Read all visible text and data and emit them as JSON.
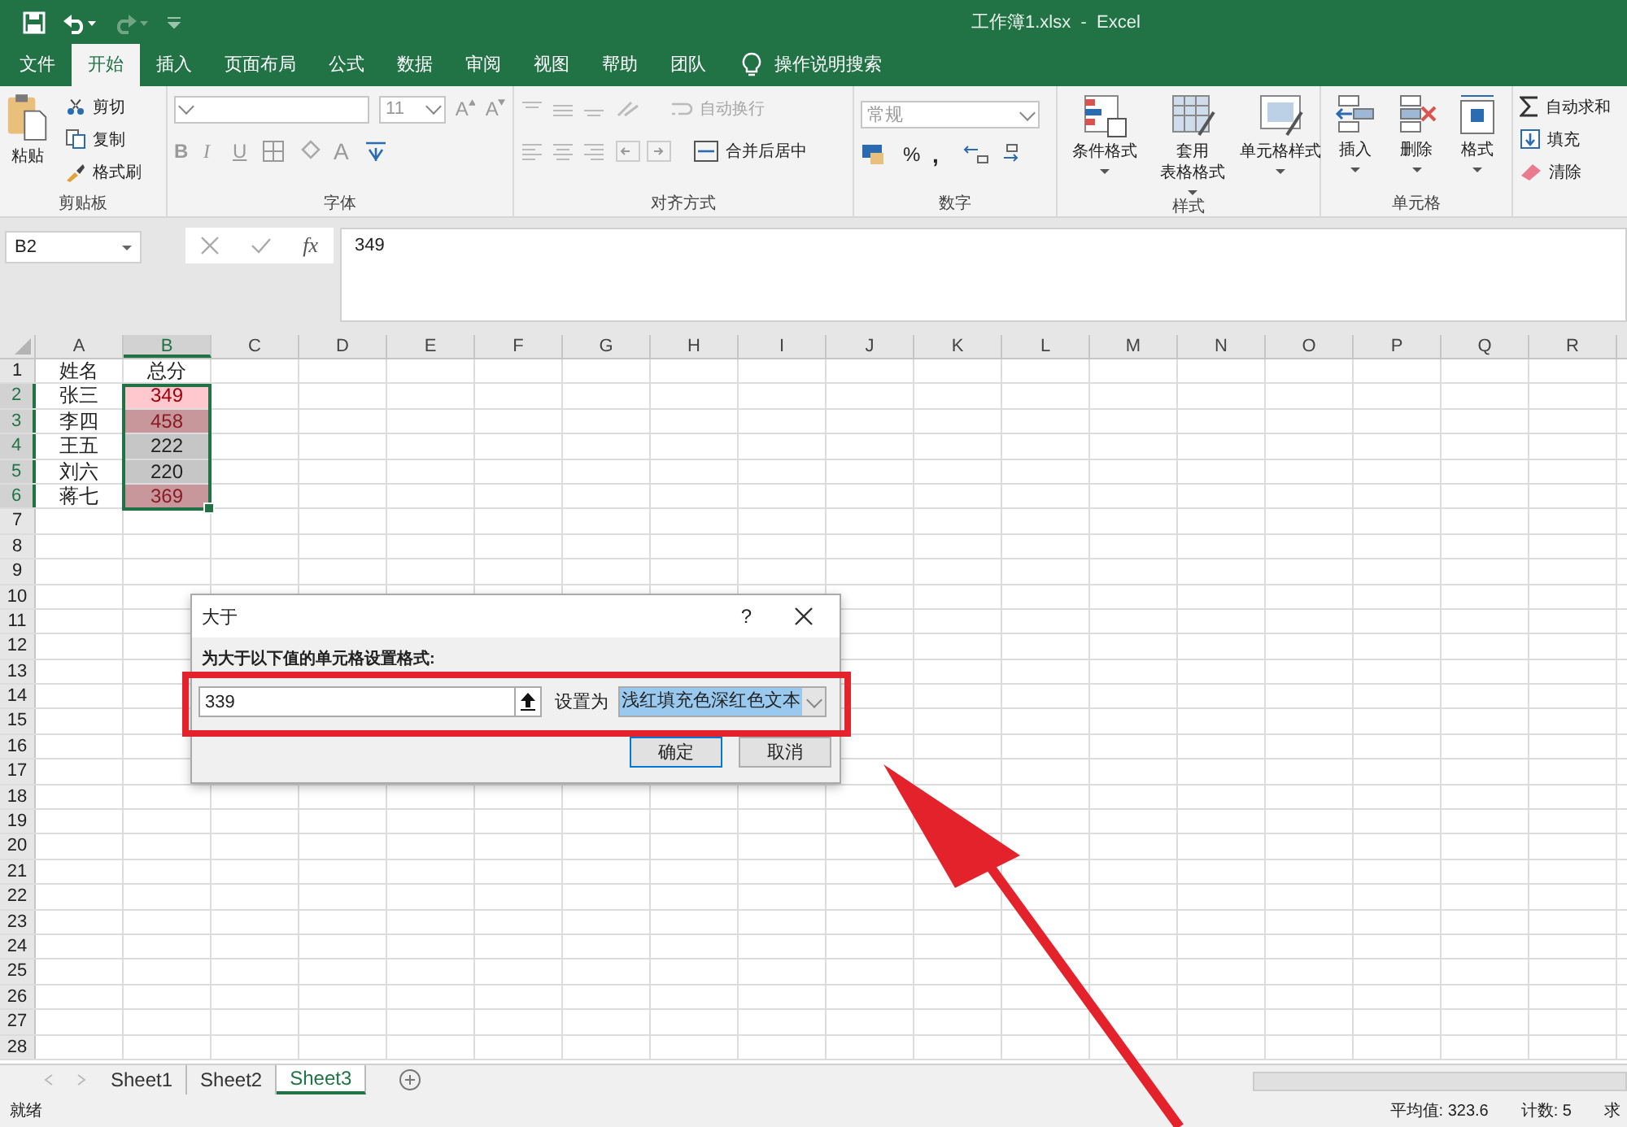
{
  "title_bar": {
    "title": "工作簿1.xlsx  -  Excel"
  },
  "ribbon_tabs": [
    {
      "label": "文件",
      "selected": false
    },
    {
      "label": "开始",
      "selected": true
    },
    {
      "label": "插入",
      "selected": false
    },
    {
      "label": "页面布局",
      "selected": false
    },
    {
      "label": "公式",
      "selected": false
    },
    {
      "label": "数据",
      "selected": false
    },
    {
      "label": "审阅",
      "selected": false
    },
    {
      "label": "视图",
      "selected": false
    },
    {
      "label": "帮助",
      "selected": false
    },
    {
      "label": "团队",
      "selected": false
    }
  ],
  "tell_me": "操作说明搜索",
  "clipboard": {
    "label": "剪贴板",
    "paste": "粘贴",
    "items": [
      "剪切",
      "复制",
      "格式刷"
    ]
  },
  "font": {
    "label": "字体",
    "font_size": "11",
    "grow": "A",
    "shrink": "A",
    "styles": [
      "B",
      "I",
      "U"
    ],
    "font_color_glyph": "A"
  },
  "alignment": {
    "label": "对齐方式",
    "wrap": {
      "label": "自动换行",
      "disabled": true
    },
    "merge": {
      "label": "合并后居中",
      "disabled": false
    }
  },
  "number": {
    "label": "数字",
    "format": "常规",
    "percent": "%",
    "comma": ","
  },
  "styles": {
    "label": "样式",
    "items": [
      {
        "lines": [
          "条件格式"
        ]
      },
      {
        "lines": [
          "套用",
          "表格格式"
        ]
      },
      {
        "lines": [
          "单元格样式"
        ]
      }
    ]
  },
  "cells": {
    "label": "单元格",
    "items": [
      "插入",
      "删除",
      "格式"
    ]
  },
  "editing": {
    "items": [
      "自动求和",
      "填充",
      "清除"
    ]
  },
  "formula_bar": {
    "name_box": "B2",
    "fx": "fx",
    "formula": "349"
  },
  "sheet": {
    "columns": [
      "A",
      "B",
      "C",
      "D",
      "E",
      "F",
      "G",
      "H",
      "I",
      "J",
      "K",
      "L",
      "M",
      "N",
      "O",
      "P",
      "Q",
      "R"
    ],
    "row_numbers": [
      "1",
      "2",
      "3",
      "4",
      "5",
      "6",
      "7",
      "8",
      "9",
      "10",
      "11",
      "12",
      "13",
      "14",
      "15",
      "16",
      "17",
      "18",
      "19",
      "20",
      "21",
      "22",
      "23",
      "24",
      "25",
      "26",
      "27",
      "28"
    ],
    "header": {
      "name": "姓名",
      "score": "总分"
    },
    "rows": [
      {
        "name": "张三",
        "score": {
          "text": "349",
          "highlight": true,
          "selected": true,
          "active": true
        }
      },
      {
        "name": "李四",
        "score": {
          "text": "458",
          "highlight": true,
          "selected": true,
          "active": false
        }
      },
      {
        "name": "王五",
        "score": {
          "text": "222",
          "highlight": false,
          "selected": true,
          "active": false
        }
      },
      {
        "name": "刘六",
        "score": {
          "text": "220",
          "highlight": false,
          "selected": true,
          "active": false
        }
      },
      {
        "name": "蒋七",
        "score": {
          "text": "369",
          "highlight": true,
          "selected": true,
          "active": false
        }
      }
    ]
  },
  "dialog": {
    "title": "大于",
    "help": "?",
    "prompt": "为大于以下值的单元格设置格式:",
    "value": "339",
    "set_label": "设置为",
    "format": "浅红填充色深红色文本",
    "buttons": [
      {
        "label": "确定",
        "default": true
      },
      {
        "label": "取消",
        "default": false
      }
    ]
  },
  "sheet_tabs": [
    {
      "label": "Sheet1",
      "selected": false
    },
    {
      "label": "Sheet2",
      "selected": false
    },
    {
      "label": "Sheet3",
      "selected": true
    }
  ],
  "status_bar": {
    "ready": "就绪",
    "average": "平均值: 323.6",
    "count": "计数: 5",
    "sum": "求"
  }
}
